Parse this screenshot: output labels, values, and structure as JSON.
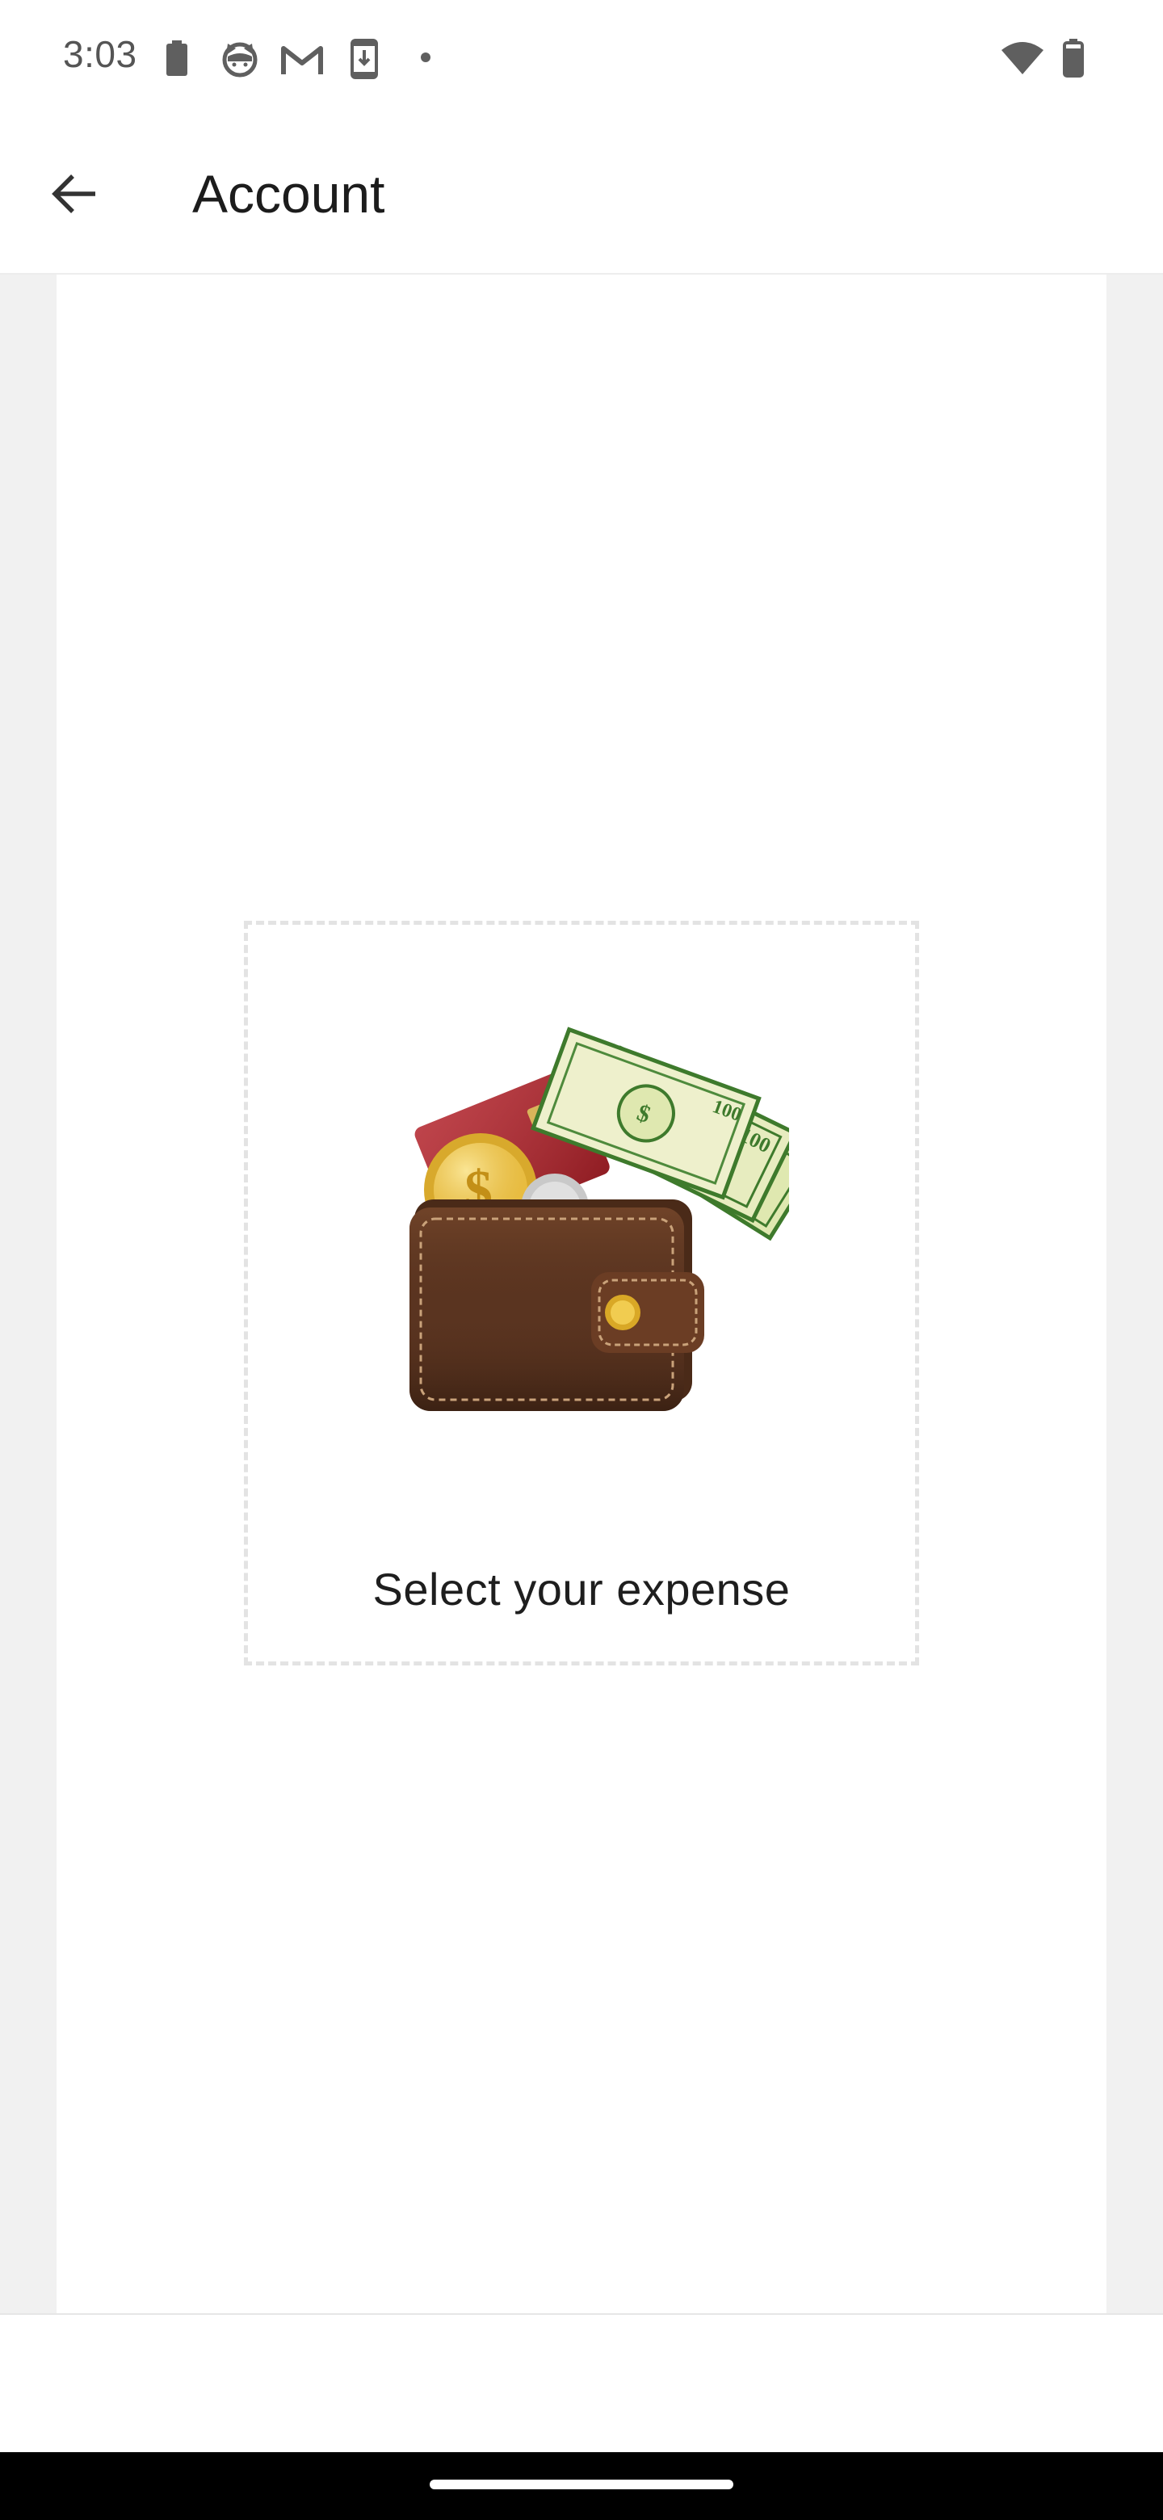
{
  "status_bar": {
    "time": "3:03",
    "icons_left": [
      "battery-saver-icon",
      "cat-face-icon",
      "gmail-icon",
      "download-phone-icon",
      "dot-icon"
    ],
    "icons_right": [
      "wifi-icon",
      "battery-icon"
    ]
  },
  "app_bar": {
    "back_icon": "arrow-back-icon",
    "title": "Account"
  },
  "expense_picker": {
    "illustration": "wallet-with-cash-card-coin",
    "label": "Select your expense"
  },
  "colors": {
    "background": "#f1f1f1",
    "card": "#ffffff",
    "dashed_border": "#e3e3e3",
    "wallet_brown": "#5a3420",
    "cash_green": "#3e7a2c",
    "credit_card_red": "#b3232b",
    "coin_gold": "#e2b53a"
  }
}
